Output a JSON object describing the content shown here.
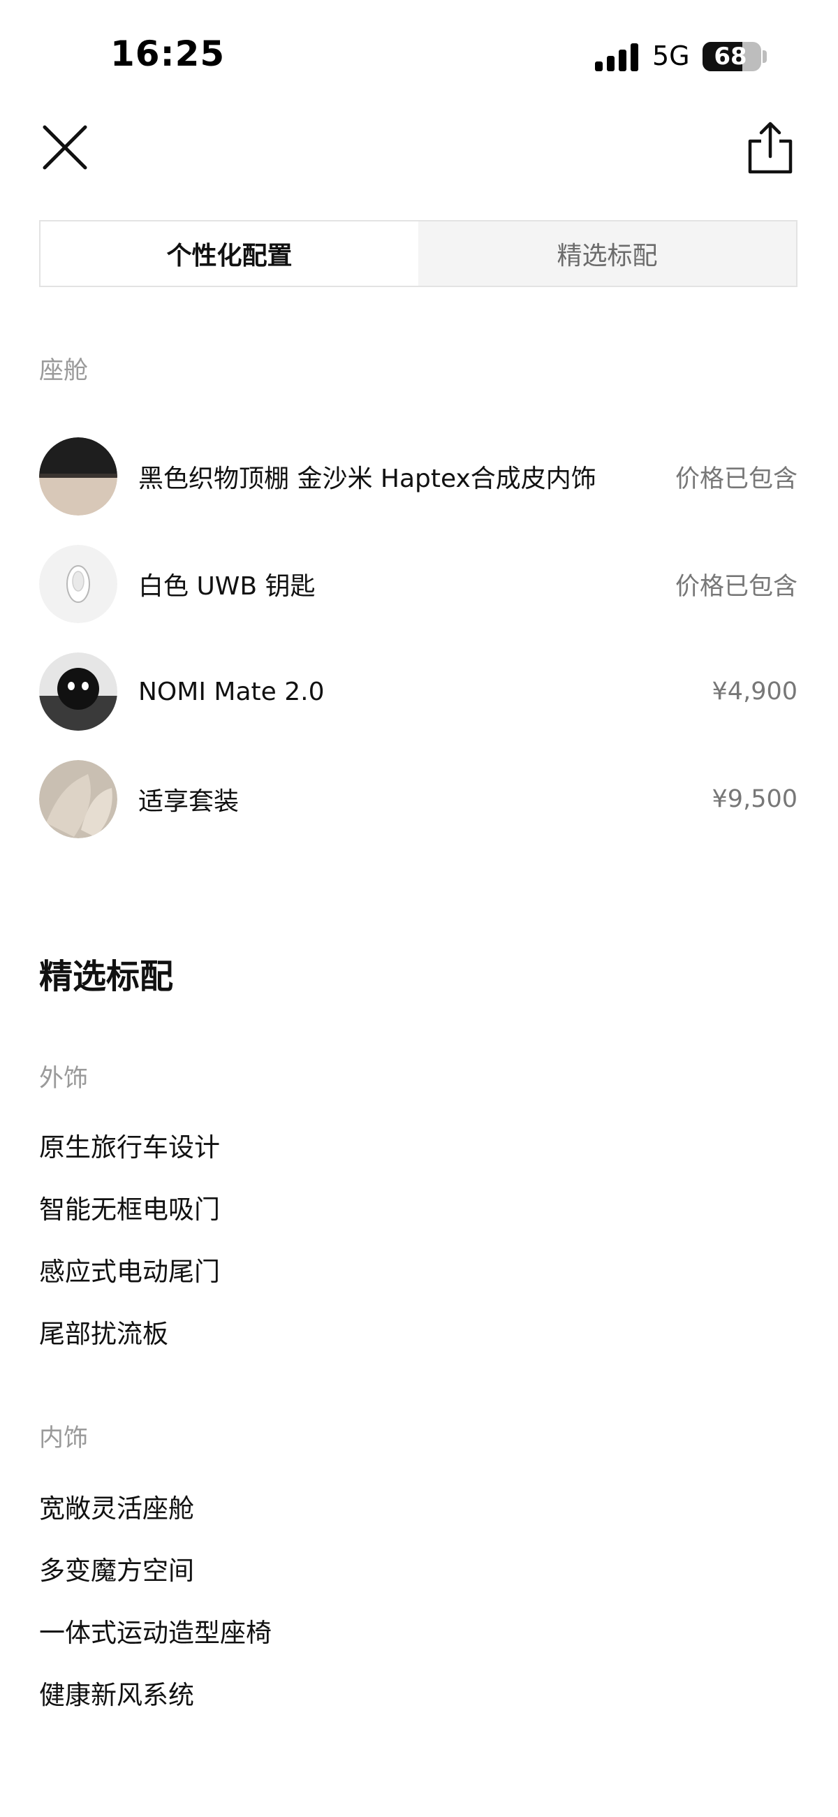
{
  "status_bar": {
    "time": "16:25",
    "network": "5G",
    "battery": "68",
    "battery_level": 0.68
  },
  "header": {
    "close_icon": "close-icon",
    "share_icon": "share-icon"
  },
  "tabs": [
    {
      "label": "个性化配置",
      "active": true
    },
    {
      "label": "精选标配",
      "active": false
    }
  ],
  "cabin": {
    "label": "座舱",
    "items": [
      {
        "name": "黑色织物顶棚 金沙米 Haptex合成皮内饰",
        "price": "价格已包含",
        "thumb": "fabric-swatch"
      },
      {
        "name": "白色 UWB 钥匙",
        "price": "价格已包含",
        "thumb": "uwb-key"
      },
      {
        "name": "NOMI Mate 2.0",
        "price": "¥4,900",
        "thumb": "nomi-mate"
      },
      {
        "name": "适享套装",
        "price": "¥9,500",
        "thumb": "seat-package"
      }
    ]
  },
  "standard": {
    "title": "精选标配",
    "exterior": {
      "label": "外饰",
      "items": [
        "原生旅行车设计",
        "智能无框电吸门",
        "感应式电动尾门",
        "尾部扰流板"
      ]
    },
    "interior": {
      "label": "内饰",
      "items": [
        "宽敞灵活座舱",
        "多变魔方空间",
        "一体式运动造型座椅",
        "健康新风系统"
      ]
    }
  }
}
